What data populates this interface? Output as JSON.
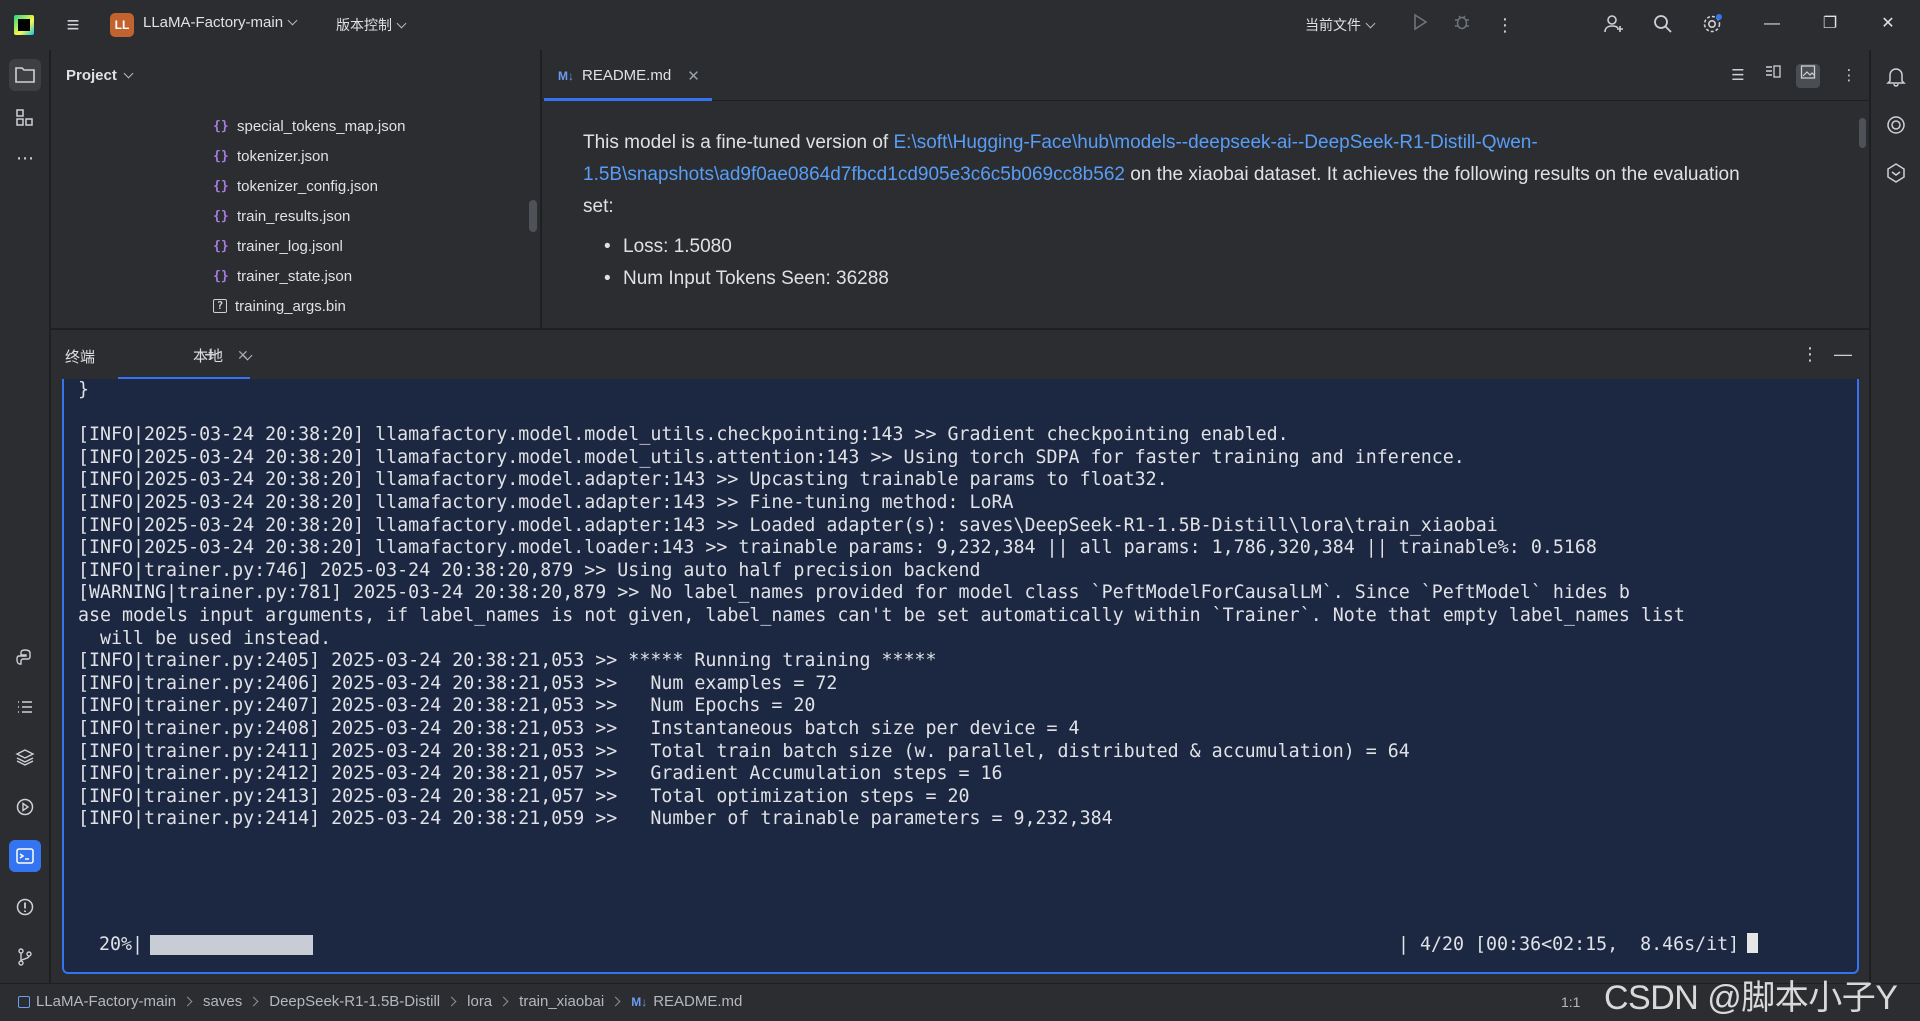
{
  "titlebar": {
    "project_badge": "LL",
    "project_name": "LLaMA-Factory-main",
    "vcs_label": "版本控制",
    "run_config": "当前文件"
  },
  "project_panel": {
    "title": "Project",
    "files": [
      {
        "name": "special_tokens_map.json",
        "icon": "json-icon"
      },
      {
        "name": "tokenizer.json",
        "icon": "json-icon"
      },
      {
        "name": "tokenizer_config.json",
        "icon": "json-icon"
      },
      {
        "name": "train_results.json",
        "icon": "json-icon"
      },
      {
        "name": "trainer_log.jsonl",
        "icon": "json-icon"
      },
      {
        "name": "trainer_state.json",
        "icon": "json-icon"
      },
      {
        "name": "training_args.bin",
        "icon": "binary-file-icon"
      }
    ]
  },
  "editor": {
    "tab_badge": "M↓",
    "tab_label": "README.md",
    "para_prefix": "This model is a fine-tuned version of ",
    "link_line1": "E:\\soft\\Hugging-Face\\hub\\models--deepseek-ai--DeepSeek-R1-Distill-Qwen-",
    "link_line2": "1.5B\\snapshots\\ad9f0ae0864d7fbcd1cd905e3c6c5b069cc8b562",
    "para_suffix": " on the xiaobai dataset. It achieves the following results on the evaluation",
    "para_suffix2": "set:",
    "bullets": [
      "Loss: 1.5080",
      "Num Input Tokens Seen: 36288"
    ]
  },
  "terminal": {
    "title": "终端",
    "tab_label": "本地",
    "lines": [
      "}",
      "",
      "[INFO|2025-03-24 20:38:20] llamafactory.model.model_utils.checkpointing:143 >> Gradient checkpointing enabled.",
      "[INFO|2025-03-24 20:38:20] llamafactory.model.model_utils.attention:143 >> Using torch SDPA for faster training and inference.",
      "[INFO|2025-03-24 20:38:20] llamafactory.model.adapter:143 >> Upcasting trainable params to float32.",
      "[INFO|2025-03-24 20:38:20] llamafactory.model.adapter:143 >> Fine-tuning method: LoRA",
      "[INFO|2025-03-24 20:38:20] llamafactory.model.adapter:143 >> Loaded adapter(s): saves\\DeepSeek-R1-1.5B-Distill\\lora\\train_xiaobai",
      "[INFO|2025-03-24 20:38:20] llamafactory.model.loader:143 >> trainable params: 9,232,384 || all params: 1,786,320,384 || trainable%: 0.5168",
      "[INFO|trainer.py:746] 2025-03-24 20:38:20,879 >> Using auto half precision backend",
      "[WARNING|trainer.py:781] 2025-03-24 20:38:20,879 >> No label_names provided for model class `PeftModelForCausalLM`. Since `PeftModel` hides b",
      "ase models input arguments, if label_names is not given, label_names can't be set automatically within `Trainer`. Note that empty label_names list",
      "  will be used instead.",
      "[INFO|trainer.py:2405] 2025-03-24 20:38:21,053 >> ***** Running training *****",
      "[INFO|trainer.py:2406] 2025-03-24 20:38:21,053 >>   Num examples = 72",
      "[INFO|trainer.py:2407] 2025-03-24 20:38:21,053 >>   Num Epochs = 20",
      "[INFO|trainer.py:2408] 2025-03-24 20:38:21,053 >>   Instantaneous batch size per device = 4",
      "[INFO|trainer.py:2411] 2025-03-24 20:38:21,053 >>   Total train batch size (w. parallel, distributed & accumulation) = 64",
      "[INFO|trainer.py:2412] 2025-03-24 20:38:21,057 >>   Gradient Accumulation steps = 16",
      "[INFO|trainer.py:2413] 2025-03-24 20:38:21,057 >>   Total optimization steps = 20",
      "[INFO|trainer.py:2414] 2025-03-24 20:38:21,059 >>   Number of trainable parameters = 9,232,384"
    ],
    "progress": {
      "percent_label": " 20%|",
      "fraction": 0.2,
      "stats": "| 4/20 [00:36<02:15,  8.46s/it]"
    }
  },
  "statusbar": {
    "breadcrumbs": [
      "LLaMA-Factory-main",
      "saves",
      "DeepSeek-R1-1.5B-Distill",
      "lora",
      "train_xiaobai",
      "README.md"
    ],
    "readme_badge": "M↓",
    "position": "1:1"
  },
  "watermark": "CSDN @脚本小子Y",
  "colors": {
    "accent": "#3574f0",
    "link": "#589df6",
    "terminal_bg": "#1c2742",
    "panel_bg": "#2b2d30",
    "project_badge": "#c2632f"
  }
}
